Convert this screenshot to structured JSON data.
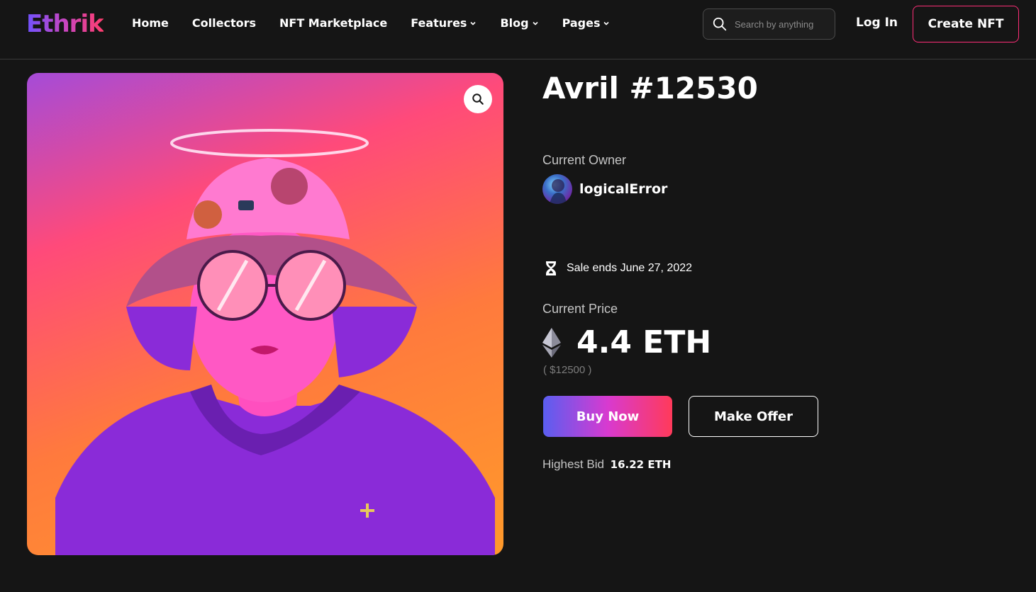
{
  "header": {
    "logo": "Ethrik",
    "nav": [
      {
        "label": "Home",
        "has_dropdown": false
      },
      {
        "label": "Collectors",
        "has_dropdown": false
      },
      {
        "label": "NFT Marketplace",
        "has_dropdown": false
      },
      {
        "label": "Features",
        "has_dropdown": true
      },
      {
        "label": "Blog",
        "has_dropdown": true
      },
      {
        "label": "Pages",
        "has_dropdown": true
      }
    ],
    "search": {
      "placeholder": "Search by anything",
      "value": "",
      "icon": "search-icon"
    },
    "login_label": "Log In",
    "create_label": "Create NFT"
  },
  "nft": {
    "title": "Avril #12530",
    "zoom_icon": "zoom-icon",
    "owner_label": "Current Owner",
    "owner_name": "logicalError",
    "sale_text": "Sale ends June 27, 2022",
    "sale_icon": "hourglass-icon",
    "price_label": "Current Price",
    "price": "4.4 ETH",
    "price_icon": "ethereum-icon",
    "usd": "( $12500 )",
    "buy_label": "Buy Now",
    "offer_label": "Make Offer",
    "bid_label": "Highest Bid",
    "bid_value": "16.22 ETH"
  },
  "colors": {
    "background": "#151515",
    "accent_pink": "#ff2e78",
    "gradient_start": "#5a5ef0",
    "gradient_end": "#ff3a5a"
  }
}
